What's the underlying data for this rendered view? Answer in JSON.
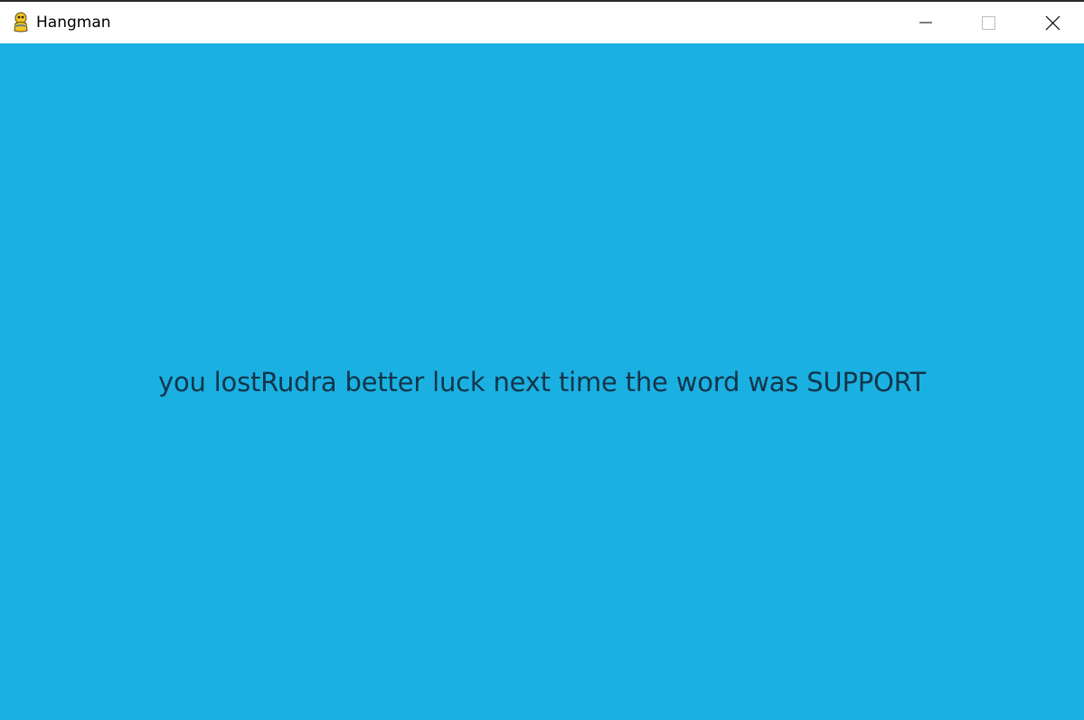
{
  "window": {
    "title": "Hangman",
    "icon": "pygame-snake-icon",
    "controls": {
      "minimize": "minimize-icon",
      "maximize": "maximize-icon",
      "close": "close-icon"
    }
  },
  "game": {
    "background_color": "#1ab1e2",
    "text_color": "#12354a",
    "message": "you lostRudra better luck next time the word was SUPPORT"
  }
}
